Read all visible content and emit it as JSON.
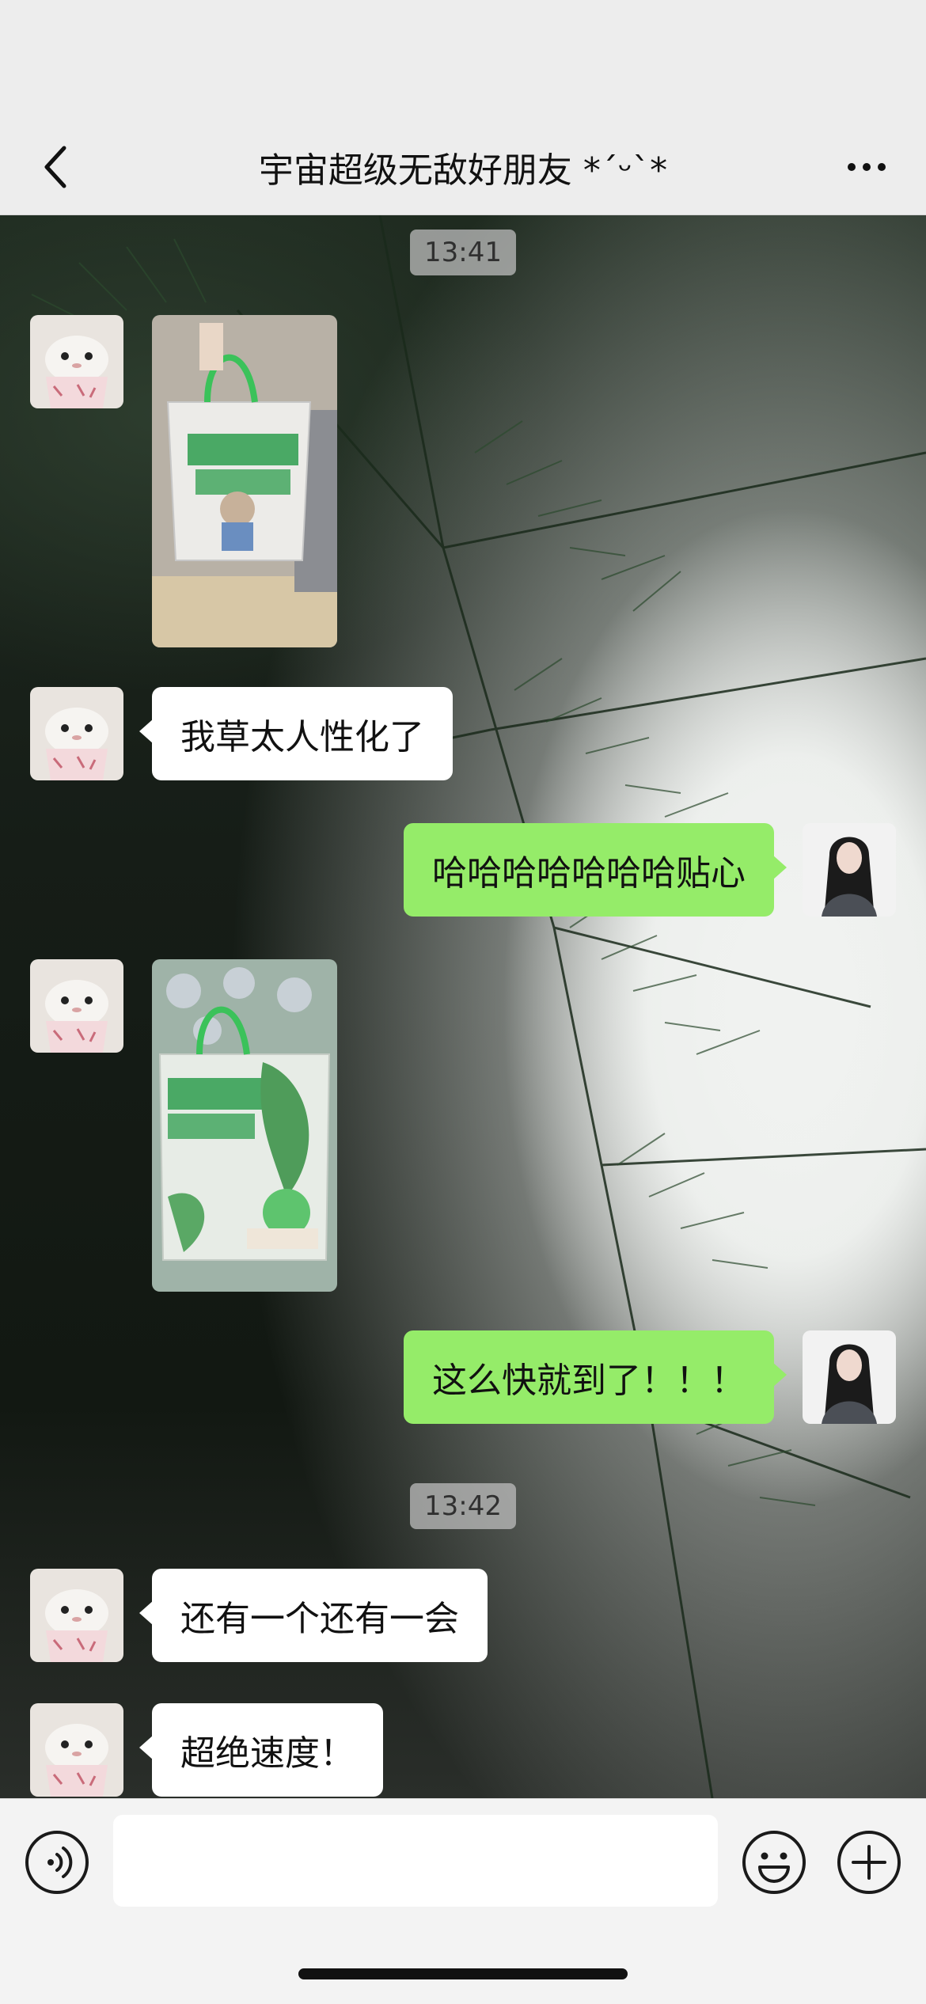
{
  "header": {
    "title": "宇宙超级无敌好朋友 *ˊᵕˋ*",
    "back_icon": "chevron-left-icon",
    "more_icon": "more-dots-icon"
  },
  "messages": {
    "time_1": "13:41",
    "time_2": "13:42",
    "msg_2": "我草太人性化了",
    "msg_3": "哈哈哈哈哈哈哈贴心",
    "msg_5": "这么快就到了！！！",
    "msg_6": "还有一个还有一会",
    "msg_7": "超绝速度！"
  },
  "input": {
    "placeholder": "",
    "value": "",
    "voice_icon": "voice-icon",
    "emoji_icon": "emoji-icon",
    "plus_icon": "plus-icon"
  },
  "colors": {
    "self_bubble": "#95ec69",
    "other_bubble": "#ffffff",
    "chrome": "#ededed"
  }
}
